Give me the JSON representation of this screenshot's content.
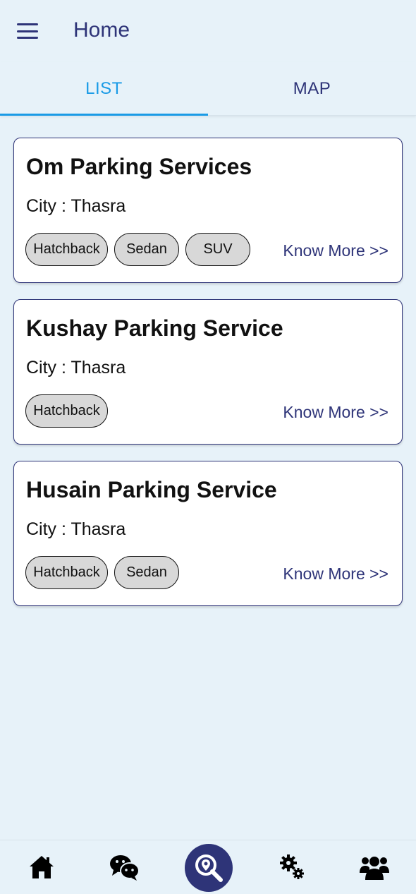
{
  "header": {
    "title": "Home"
  },
  "tabs": [
    {
      "label": "LIST",
      "active": true
    },
    {
      "label": "MAP",
      "active": false
    }
  ],
  "cards": [
    {
      "title": "Om Parking Services",
      "city": "City : Thasra",
      "chips": [
        "Hatchback",
        "Sedan",
        "SUV"
      ],
      "link": "Know More >>"
    },
    {
      "title": "Kushay Parking Service",
      "city": "City : Thasra",
      "chips": [
        "Hatchback"
      ],
      "link": "Know More >>"
    },
    {
      "title": "Husain Parking Service",
      "city": "City : Thasra",
      "chips": [
        "Hatchback",
        "Sedan"
      ],
      "link": "Know More >>"
    }
  ],
  "bottom_nav": {
    "items": [
      "home-icon",
      "chat-icon",
      "search-location-icon",
      "settings-icon",
      "users-icon"
    ],
    "active": "search-location-icon"
  },
  "colors": {
    "primary": "#2e3478",
    "accent": "#1a9be6",
    "background": "#e7f2f9",
    "chip": "#d8d8d8"
  }
}
